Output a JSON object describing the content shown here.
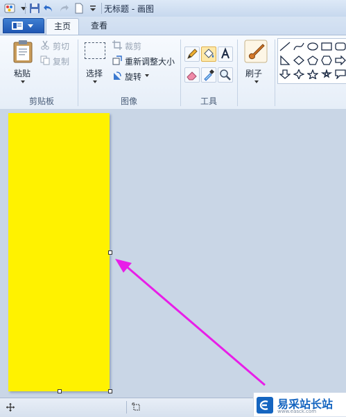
{
  "window": {
    "title": "无标题 - 画图"
  },
  "tabs": {
    "home": "主页",
    "view": "查看"
  },
  "clipboard": {
    "paste": "粘贴",
    "cut": "剪切",
    "copy": "复制",
    "group": "剪贴板"
  },
  "image": {
    "select": "选择",
    "crop": "裁剪",
    "resize": "重新调整大小",
    "rotate": "旋转",
    "group": "图像"
  },
  "tools": {
    "group": "工具"
  },
  "brushes": {
    "label": "刷子"
  },
  "watermark": {
    "text": "易采站长站",
    "subtitle": "www.easck.com"
  },
  "colors": {
    "canvas": "#fff200",
    "arrow": "#e81ee8",
    "accent": "#1f57b3"
  }
}
